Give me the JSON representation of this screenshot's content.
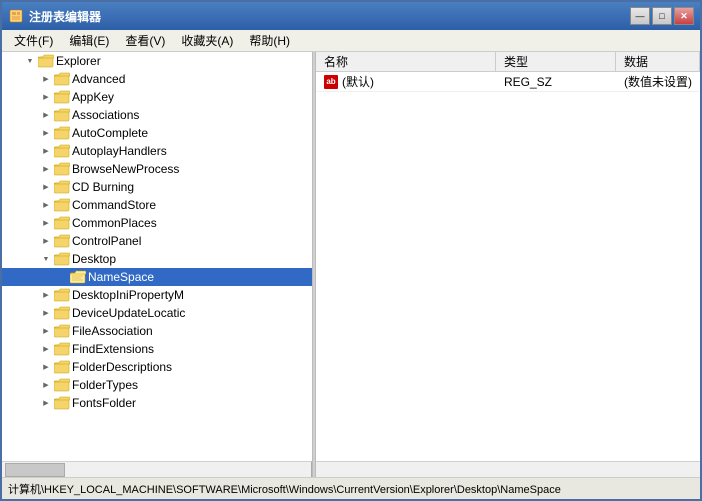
{
  "window": {
    "title": "注册表编辑器",
    "icon": "regedit-icon"
  },
  "menubar": {
    "items": [
      "文件(F)",
      "编辑(E)",
      "查看(V)",
      "收藏夹(A)",
      "帮助(H)"
    ]
  },
  "tree": {
    "items": [
      {
        "id": "explorer",
        "label": "Explorer",
        "level": 1,
        "expanded": true,
        "expand_state": "expanded"
      },
      {
        "id": "advanced",
        "label": "Advanced",
        "level": 2,
        "expanded": false,
        "expand_state": "has-expand"
      },
      {
        "id": "appkey",
        "label": "AppKey",
        "level": 2,
        "expanded": false,
        "expand_state": "has-expand"
      },
      {
        "id": "associations",
        "label": "Associations",
        "level": 2,
        "expanded": false,
        "expand_state": "has-expand"
      },
      {
        "id": "autocomplete",
        "label": "AutoComplete",
        "level": 2,
        "expanded": false,
        "expand_state": "has-expand"
      },
      {
        "id": "autoplayhandlers",
        "label": "AutoplayHandlers",
        "level": 2,
        "expanded": false,
        "expand_state": "has-expand"
      },
      {
        "id": "browsenewprocess",
        "label": "BrowseNewProcess",
        "level": 2,
        "expanded": false,
        "expand_state": "has-expand"
      },
      {
        "id": "cdburning",
        "label": "CD Burning",
        "level": 2,
        "expanded": false,
        "expand_state": "has-expand"
      },
      {
        "id": "commandstore",
        "label": "CommandStore",
        "level": 2,
        "expanded": false,
        "expand_state": "has-expand"
      },
      {
        "id": "commonplaces",
        "label": "CommonPlaces",
        "level": 2,
        "expanded": false,
        "expand_state": "has-expand"
      },
      {
        "id": "controlpanel",
        "label": "ControlPanel",
        "level": 2,
        "expanded": false,
        "expand_state": "has-expand"
      },
      {
        "id": "desktop",
        "label": "Desktop",
        "level": 2,
        "expanded": true,
        "expand_state": "expanded"
      },
      {
        "id": "namespace",
        "label": "NameSpace",
        "level": 3,
        "expanded": false,
        "expand_state": "empty",
        "selected": true
      },
      {
        "id": "desktopinipropertym",
        "label": "DesktopIniPropertyM",
        "level": 2,
        "expanded": false,
        "expand_state": "has-expand"
      },
      {
        "id": "deviceupdatelocatic",
        "label": "DeviceUpdateLocatic",
        "level": 2,
        "expanded": false,
        "expand_state": "has-expand"
      },
      {
        "id": "fileassociation",
        "label": "FileAssociation",
        "level": 2,
        "expanded": false,
        "expand_state": "has-expand"
      },
      {
        "id": "findextensions",
        "label": "FindExtensions",
        "level": 2,
        "expanded": false,
        "expand_state": "has-expand"
      },
      {
        "id": "folderdescriptions",
        "label": "FolderDescriptions",
        "level": 2,
        "expanded": false,
        "expand_state": "has-expand"
      },
      {
        "id": "foldertypes",
        "label": "FolderTypes",
        "level": 2,
        "expanded": false,
        "expand_state": "has-expand"
      },
      {
        "id": "fontsfolder",
        "label": "FontsFolder",
        "level": 2,
        "expanded": false,
        "expand_state": "has-expand"
      }
    ]
  },
  "right_panel": {
    "headers": [
      "名称",
      "类型",
      "数据"
    ],
    "rows": [
      {
        "name": "(默认)",
        "type": "REG_SZ",
        "data": "(数值未设置)",
        "icon": "ab-icon"
      }
    ]
  },
  "statusbar": {
    "text": "计算机\\HKEY_LOCAL_MACHINE\\SOFTWARE\\Microsoft\\Windows\\CurrentVersion\\Explorer\\Desktop\\NameSpace"
  },
  "titlebar_buttons": {
    "minimize": "—",
    "maximize": "□",
    "close": "✕"
  }
}
